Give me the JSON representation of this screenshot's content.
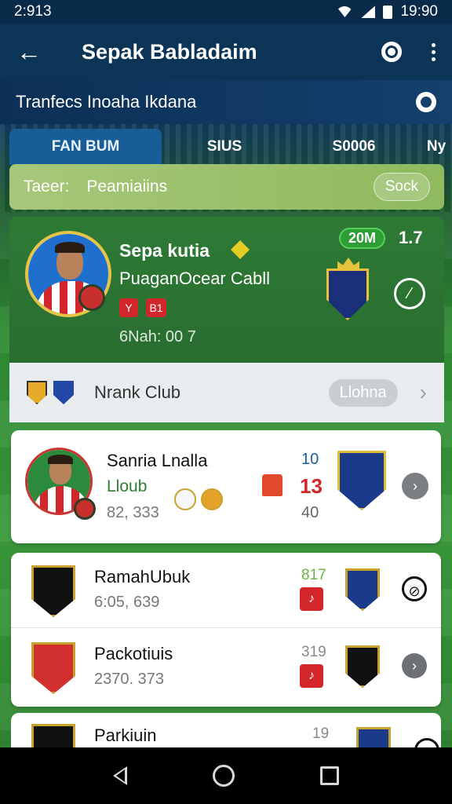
{
  "status_bar": {
    "time_left": "2:913",
    "time_right": "19:90"
  },
  "app_bar": {
    "title": "Sepak Babladaim"
  },
  "subheader": {
    "text": "Tranfecs Inoaha Ikdana"
  },
  "tabs": [
    {
      "label": "FAN BUM",
      "active": true
    },
    {
      "label": "SIUS",
      "active": false
    },
    {
      "label": "S0006",
      "active": false
    },
    {
      "label": "Ny",
      "active": false
    }
  ],
  "filter": {
    "label": "Taeer:",
    "value": "Peamiaiins",
    "sort_label": "Sock"
  },
  "featured": {
    "name": "Sepa kutia",
    "club": "PuaganOcear Cabll",
    "chip_2": "B1",
    "meta": "6Nah: 00 7",
    "badge": "20M",
    "rating": "1.7"
  },
  "club_header": {
    "label": "Nrank Club",
    "pill": "Llohna"
  },
  "player_card": {
    "name": "Sanria Lnalla",
    "club": "Lloub",
    "meta": "82, 333",
    "num_top": "10",
    "num_mid": "13",
    "num_bot": "40"
  },
  "clubs": [
    {
      "name": "RamahUbuk",
      "meta": "6:05, 639",
      "num": "817"
    },
    {
      "name": "Packotiuis",
      "meta": "2370. 373",
      "num": "319"
    }
  ],
  "partial": {
    "name": "Parkiuin",
    "num": "19"
  },
  "colors": {
    "primary": "#0b3457",
    "accent_green": "#2d7a34",
    "accent_red": "#d3262b"
  },
  "icons": [
    "back-arrow-icon",
    "gear-icon",
    "more-vert-icon",
    "globe-icon",
    "star-icon",
    "chevron-right-icon",
    "nav-back-icon",
    "nav-home-icon",
    "nav-recent-icon"
  ]
}
